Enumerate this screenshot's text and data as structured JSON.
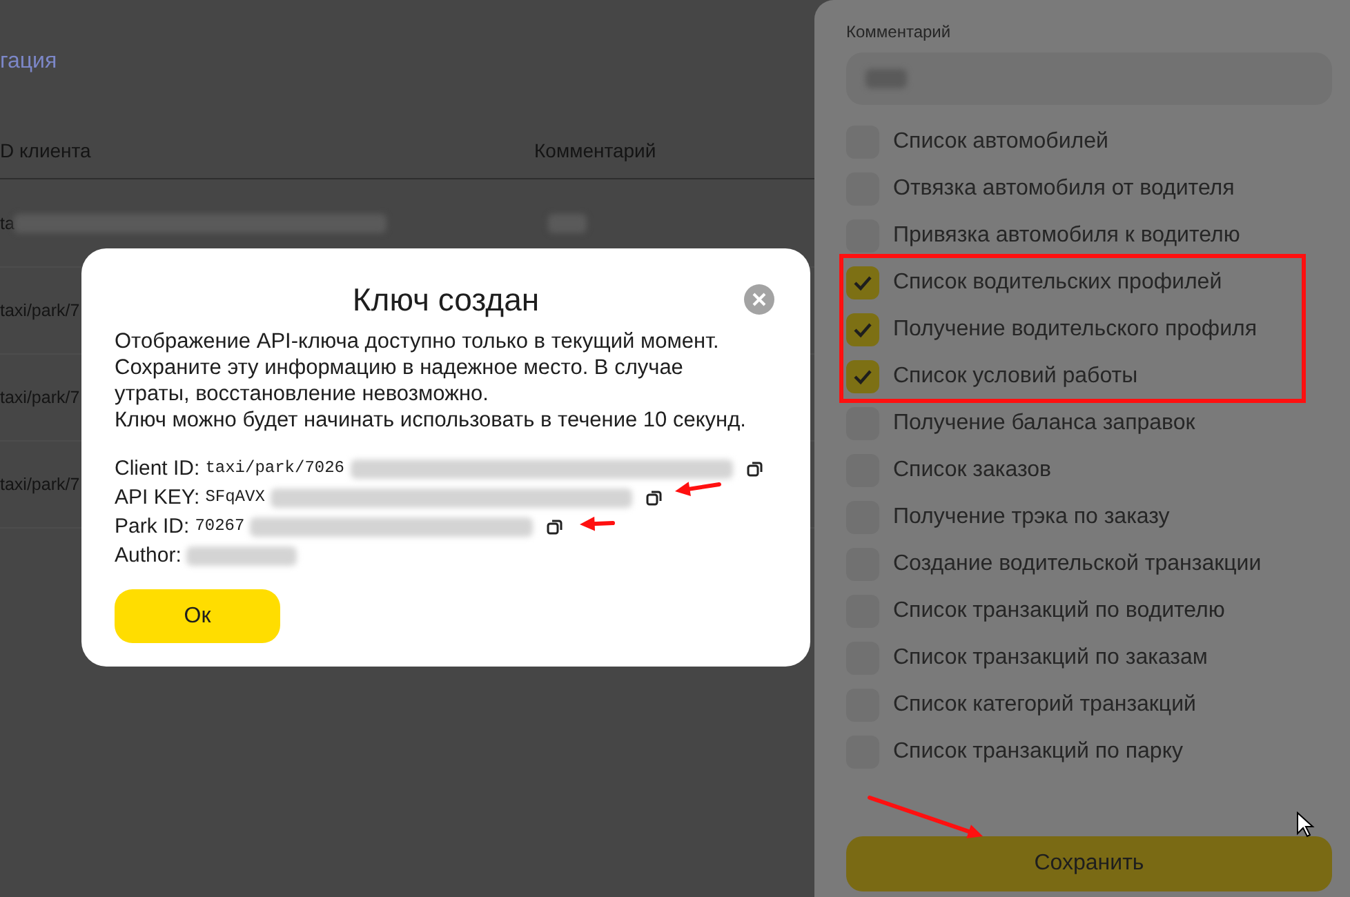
{
  "background_page": {
    "link": "гация",
    "table": {
      "columns": [
        "D клиента",
        "Комментарий"
      ],
      "rows": [
        {
          "client_id": "ta"
        },
        {
          "client_id": "taxi/park/7"
        },
        {
          "client_id": "taxi/park/7"
        },
        {
          "client_id": "taxi/park/7"
        }
      ]
    }
  },
  "dialog": {
    "title": "Ключ создан",
    "message_lines": [
      "Отображение API-ключа доступно только в текущий момент.",
      "Сохраните эту информацию в надежное место. В случае утраты, восстановление невозможно.",
      "Ключ можно будет начинать использовать в течение 10 секунд."
    ],
    "fields": [
      {
        "label": "Client ID:",
        "value": "taxi/park/7026",
        "copyable": true
      },
      {
        "label": "API KEY:",
        "value": "SFqAVX",
        "copyable": true
      },
      {
        "label": "Park ID:",
        "value": "70267",
        "copyable": true
      },
      {
        "label": "Author:",
        "copyable": false
      }
    ],
    "ok_button": "Ок"
  },
  "side_panel": {
    "comment_label": "Комментарий",
    "permissions": [
      {
        "label": "Список автомобилей",
        "checked": false
      },
      {
        "label": "Отвязка автомобиля от водителя",
        "checked": false
      },
      {
        "label": "Привязка автомобиля к водителю",
        "checked": false
      },
      {
        "label": "Список водительских профилей",
        "checked": true
      },
      {
        "label": "Получение водительского профиля",
        "checked": true
      },
      {
        "label": "Список условий работы",
        "checked": true
      },
      {
        "label": "Получение баланса заправок",
        "checked": false
      },
      {
        "label": "Список заказов",
        "checked": false
      },
      {
        "label": "Получение трэка по заказу",
        "checked": false
      },
      {
        "label": "Создание водительской транзакции",
        "checked": false
      },
      {
        "label": "Список транзакций по водителю",
        "checked": false
      },
      {
        "label": "Список транзакций по заказам",
        "checked": false
      },
      {
        "label": "Список категорий транзакций",
        "checked": false
      },
      {
        "label": "Список транзакций по парку",
        "checked": false
      }
    ],
    "save_button": "Сохранить"
  }
}
